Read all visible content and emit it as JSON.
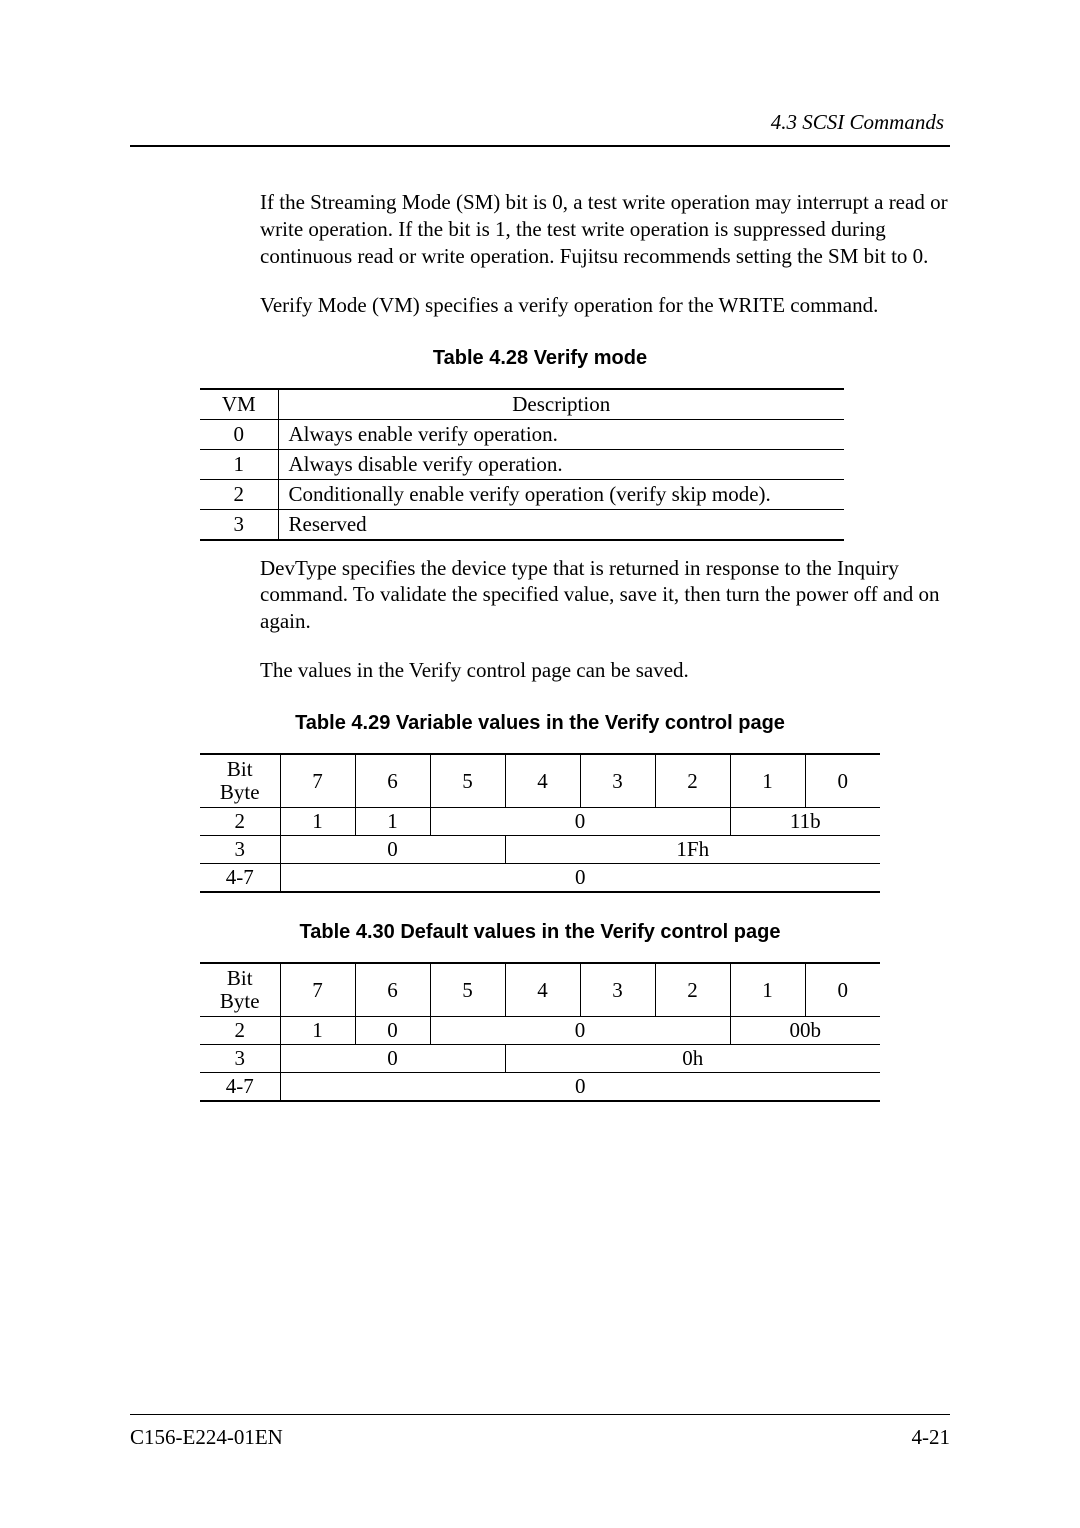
{
  "header": {
    "section": "4.3  SCSI Commands"
  },
  "paragraphs": {
    "p1": "If the Streaming Mode (SM) bit is 0, a test write operation may interrupt a read or write operation.  If the bit is 1, the test write operation is suppressed during continuous read or write operation.  Fujitsu recommends setting the SM bit to 0.",
    "p2": "Verify Mode (VM) specifies a verify operation for the WRITE command.",
    "p3": "DevType specifies the device type that is returned in response to the Inquiry command.  To validate the specified value, save it, then turn the power off and on again.",
    "p4": "The values in the Verify control page can be saved."
  },
  "table28": {
    "caption": "Table 4.28  Verify mode",
    "headers": {
      "vm": "VM",
      "desc": "Description"
    },
    "rows": [
      {
        "vm": "0",
        "desc": "Always enable verify operation."
      },
      {
        "vm": "1",
        "desc": "Always disable verify operation."
      },
      {
        "vm": "2",
        "desc": "Conditionally enable verify operation (verify skip mode)."
      },
      {
        "vm": "3",
        "desc": "Reserved"
      }
    ]
  },
  "table29": {
    "caption": "Table 4.29  Variable values in the Verify control page",
    "bitByteLabel": {
      "line1": "Bit",
      "line2": "Byte"
    },
    "bits": [
      "7",
      "6",
      "5",
      "4",
      "3",
      "2",
      "1",
      "0"
    ],
    "rows": {
      "r2": {
        "byte": "2",
        "b7": "1",
        "b6": "1",
        "merge_5_2": "0",
        "merge_1_0": "11b"
      },
      "r3": {
        "byte": "3",
        "merge_7_5": "0",
        "merge_4_0": "1Fh"
      },
      "r4": {
        "byte": "4-7",
        "merge_all": "0"
      }
    }
  },
  "table30": {
    "caption": "Table 4.30  Default values in the Verify control page",
    "bitByteLabel": {
      "line1": "Bit",
      "line2": "Byte"
    },
    "bits": [
      "7",
      "6",
      "5",
      "4",
      "3",
      "2",
      "1",
      "0"
    ],
    "rows": {
      "r2": {
        "byte": "2",
        "b7": "1",
        "b6": "0",
        "merge_5_2": "0",
        "merge_1_0": "00b"
      },
      "r3": {
        "byte": "3",
        "merge_7_5": "0",
        "merge_4_0": "0h"
      },
      "r4": {
        "byte": "4-7",
        "merge_all": "0"
      }
    }
  },
  "footer": {
    "left": "C156-E224-01EN",
    "right": "4-21"
  },
  "chart_data": [
    {
      "type": "table",
      "title": "Table 4.28 Verify mode",
      "columns": [
        "VM",
        "Description"
      ],
      "rows": [
        [
          "0",
          "Always enable verify operation."
        ],
        [
          "1",
          "Always disable verify operation."
        ],
        [
          "2",
          "Conditionally enable verify operation (verify skip mode)."
        ],
        [
          "3",
          "Reserved"
        ]
      ]
    },
    {
      "type": "table",
      "title": "Table 4.29 Variable values in the Verify control page",
      "columns": [
        "Byte",
        "Bit7",
        "Bit6",
        "Bit5",
        "Bit4",
        "Bit3",
        "Bit2",
        "Bit1",
        "Bit0"
      ],
      "rows": [
        [
          "2",
          "1",
          "1",
          "0",
          "0",
          "0",
          "0",
          "1",
          "1"
        ],
        [
          "3",
          "0",
          "0",
          "0",
          "1",
          "1",
          "1",
          "1",
          "1"
        ],
        [
          "4-7",
          "0",
          "0",
          "0",
          "0",
          "0",
          "0",
          "0",
          "0"
        ]
      ],
      "notes": "Byte2 bits1-0 shown as 11b; Byte3 bits4-0 shown as 1Fh"
    },
    {
      "type": "table",
      "title": "Table 4.30 Default values in the Verify control page",
      "columns": [
        "Byte",
        "Bit7",
        "Bit6",
        "Bit5",
        "Bit4",
        "Bit3",
        "Bit2",
        "Bit1",
        "Bit0"
      ],
      "rows": [
        [
          "2",
          "1",
          "0",
          "0",
          "0",
          "0",
          "0",
          "0",
          "0"
        ],
        [
          "3",
          "0",
          "0",
          "0",
          "0",
          "0",
          "0",
          "0",
          "0"
        ],
        [
          "4-7",
          "0",
          "0",
          "0",
          "0",
          "0",
          "0",
          "0",
          "0"
        ]
      ],
      "notes": "Byte2 bits1-0 shown as 00b; Byte3 bits4-0 shown as 0h"
    }
  ]
}
